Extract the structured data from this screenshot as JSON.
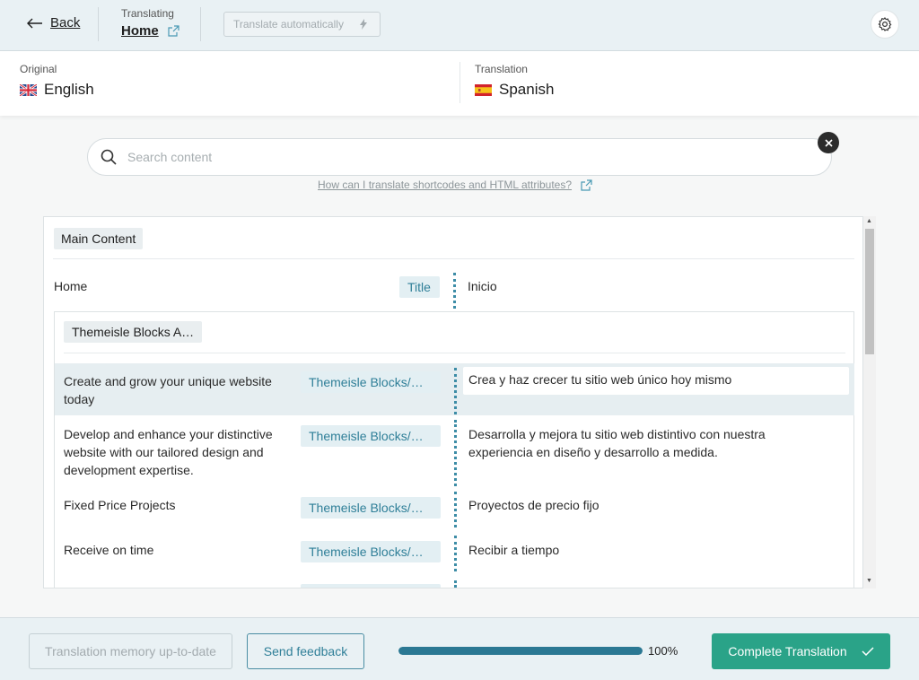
{
  "header": {
    "back_label": "Back",
    "translating_label": "Translating",
    "page_name": "Home",
    "auto_translate_label": "Translate automatically"
  },
  "languages": {
    "original_label": "Original",
    "original_lang": "English",
    "translation_label": "Translation",
    "translation_lang": "Spanish"
  },
  "search": {
    "placeholder": "Search content",
    "help_link": "How can I translate shortcodes and HTML attributes?"
  },
  "content": {
    "section_label": "Main Content",
    "title_row": {
      "source": "Home",
      "tag": "Title",
      "target": "Inicio"
    },
    "block_label": "Themeisle Blocks A…",
    "rows": [
      {
        "source": "Create and grow your unique website today",
        "tag": "Themeisle Blocks/…",
        "target": "Crea y haz crecer tu sitio web único hoy mismo"
      },
      {
        "source": "Develop and enhance your distinctive website with our tailored design and development expertise.",
        "tag": "Themeisle Blocks/…",
        "target": "Desarrolla y mejora tu sitio web distintivo con nuestra experiencia en diseño y desarrollo a medida."
      },
      {
        "source": "Fixed Price Projects",
        "tag": "Themeisle Blocks/…",
        "target": "Proyectos de precio fijo"
      },
      {
        "source": "Receive on time",
        "tag": "Themeisle Blocks/…",
        "target": "Recibir a tiempo"
      }
    ]
  },
  "footer": {
    "memory_label": "Translation memory up-to-date",
    "feedback_label": "Send feedback",
    "progress_fraction": 1.0,
    "progress_text": "100%",
    "complete_label": "Complete Translation"
  },
  "colors": {
    "accent": "#2aa388",
    "progress": "#2b7893",
    "tag_text": "#2f7f98"
  }
}
